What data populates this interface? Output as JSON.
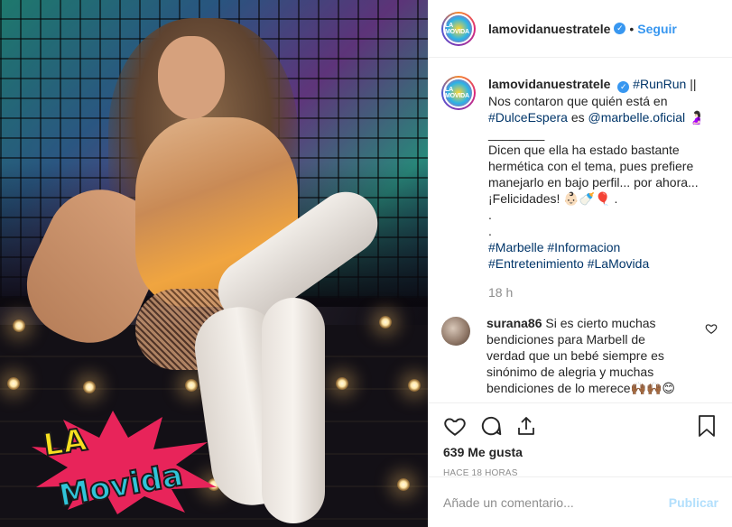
{
  "post": {
    "username": "lamovidanuestratele",
    "verified_icon": "verified-badge-icon",
    "separator": "•",
    "follow_label": "Seguir",
    "avatar_text": "LA MOVIDA"
  },
  "caption": {
    "username": "lamovidanuestratele",
    "lines": [
      {
        "text": "#RunRun",
        "tag": true
      },
      {
        "text": " ||",
        "tag": false
      }
    ],
    "line2_prefix": "Nos contaron que quién está en ",
    "tag_dulce": "#DulceEspera",
    "mid": " es ",
    "mention": "@marbelle.oficial",
    "emoji_after_mention": " 🤰🏻",
    "divider": "________",
    "body": "Dicen que ella ha estado bastante hermética con el tema, pues prefiere manejarlo en bajo perfil... por ahora... ¡Felicidades! 👶🏻🍼🎈 .",
    "dot1": ".",
    "dot2": ".",
    "tags1": [
      "#Marbelle",
      "#Informacion"
    ],
    "tags2": [
      "#Entretenimiento",
      "#LaMovida"
    ],
    "time": "18 h"
  },
  "comment": {
    "username": "surana86",
    "text": "Si es cierto muchas bendiciones para Marbell de verdad que un bebé siempre es sinónimo de alegria y muchas bendiciones de lo merece🙌🏾🙌🏾😊"
  },
  "actions": {
    "likes": "639 Me gusta",
    "ago": "HACE 18 HORAS",
    "comment_placeholder": "Añade un comentario...",
    "publish_label": "Publicar"
  },
  "photo": {
    "logo_line1": "LA",
    "logo_line2": "Movida",
    "colors": {
      "logo_burst": "#e8245a",
      "logo_text": "#f7e020",
      "logo_text2": "#30c4d8"
    }
  }
}
